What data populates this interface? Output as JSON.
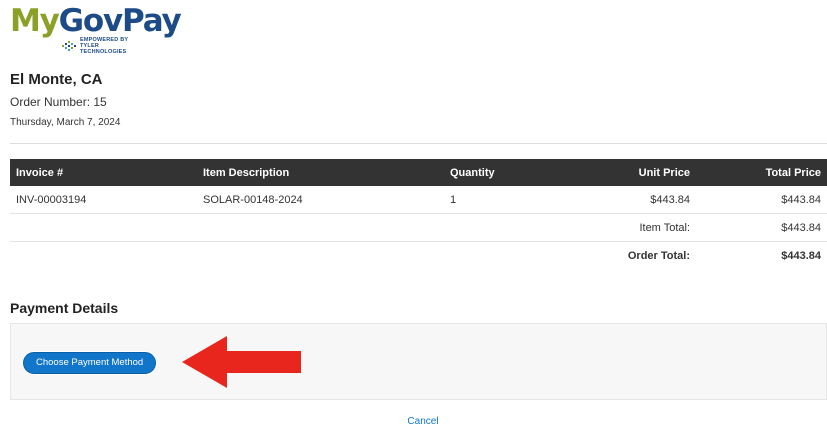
{
  "logo": {
    "part1": "My",
    "part2": "GovPay",
    "powered_line1": "Empowered by",
    "powered_line2": "Tyler Technologies",
    "colors": {
      "my": "#8aa026",
      "govpay": "#1c4b87"
    }
  },
  "header": {
    "city": "El Monte, CA",
    "order_number": "Order Number: 15",
    "date": "Thursday, March 7, 2024"
  },
  "table": {
    "columns": [
      "Invoice #",
      "Item Description",
      "Quantity",
      "Unit Price",
      "Total Price"
    ],
    "rows": [
      {
        "invoice": "INV-00003194",
        "description": "SOLAR-00148-2024",
        "quantity": "1",
        "unit_price": "$443.84",
        "total_price": "$443.84"
      }
    ],
    "item_total_label": "Item Total:",
    "item_total_value": "$443.84",
    "order_total_label": "Order Total:",
    "order_total_value": "$443.84",
    "header_bg": "#333333"
  },
  "payment": {
    "title": "Payment Details",
    "button_label": "Choose Payment Method",
    "button_color": "#1176c9",
    "annotation_arrow_color": "#e8261d"
  },
  "footer": {
    "cancel_label": "Cancel"
  }
}
